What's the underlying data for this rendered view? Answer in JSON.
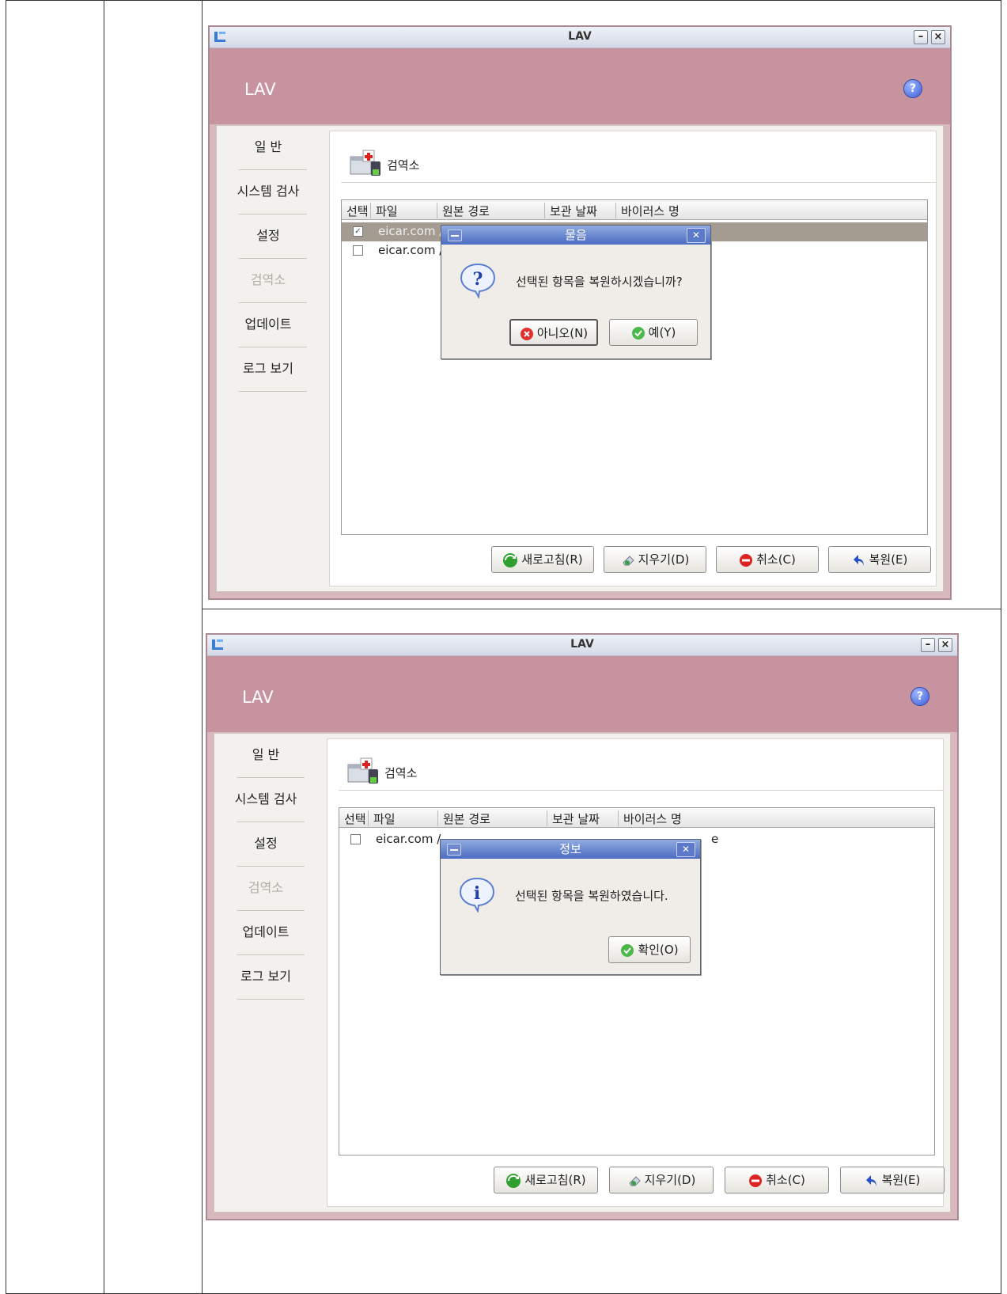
{
  "window": {
    "title": "LAV",
    "minimize": "–",
    "close": "×",
    "brand": "LAV",
    "help": "?"
  },
  "nav": [
    "일 반",
    "시스템 검사",
    "설정",
    "검역소",
    "업데이트",
    "로그 보기"
  ],
  "panel": {
    "title": "검역소",
    "columns": [
      "선택",
      "파일",
      "원본 경로",
      "보관 날짜",
      "바이러스 명"
    ]
  },
  "buttons": {
    "refresh": "새로고침(R)",
    "delete": "지우기(D)",
    "cancel": "취소(C)",
    "restore": "복원(E)"
  },
  "screen1": {
    "rows": [
      {
        "checked": "✓",
        "file": "eicar.com",
        "path": "/"
      },
      {
        "checked": "",
        "file": "eicar.com",
        "path": "/"
      }
    ],
    "dialog": {
      "title": "물음",
      "message": "선택된 항목을 복원하시겠습니까?",
      "no": "아니오(N)",
      "yes": "예(Y)"
    }
  },
  "screen2": {
    "rows": [
      {
        "checked": "",
        "file": "eicar.com",
        "path": "/",
        "trail": "e"
      }
    ],
    "dialog": {
      "title": "정보",
      "message": "선택된 항목을 복원하였습니다.",
      "ok": "확인(O)"
    }
  },
  "colors": {
    "header": "#c7939f",
    "frame": "#d7b8bd",
    "dialog_title": "#4c6cc2",
    "selected_row": "#a59c91"
  }
}
